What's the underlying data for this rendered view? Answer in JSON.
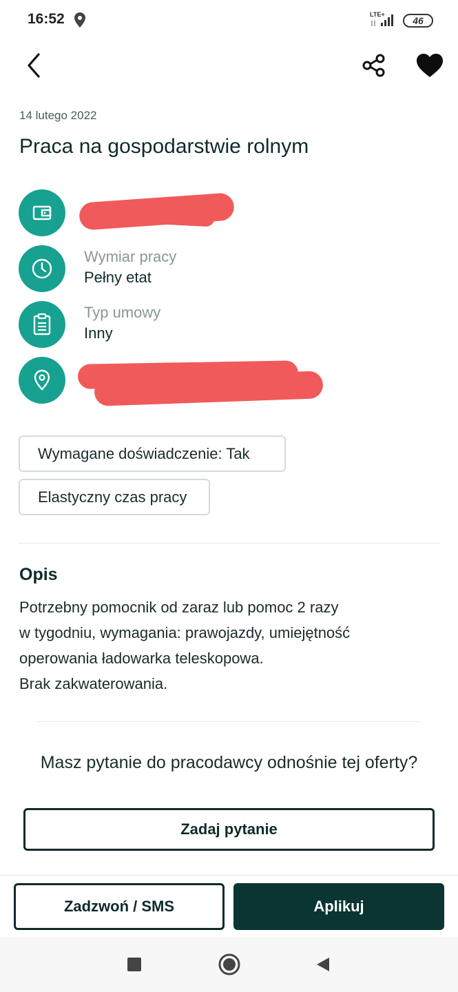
{
  "status_bar": {
    "time": "16:52",
    "network": "LTE+",
    "battery": "46"
  },
  "header": {
    "back_icon": "chevron-left-icon",
    "share_icon": "share-icon",
    "favorite_icon": "heart-icon"
  },
  "job": {
    "date": "14 lutego 2022",
    "title": "Praca na gospodarstwie rolnym",
    "info": [
      {
        "icon": "wallet-icon",
        "label": "",
        "value": "",
        "redacted": true
      },
      {
        "icon": "clock-icon",
        "label": "Wymiar pracy",
        "value": "Pełny etat"
      },
      {
        "icon": "clipboard-icon",
        "label": "Typ umowy",
        "value": "Inny"
      },
      {
        "icon": "location-pin-icon",
        "label": "",
        "value": "",
        "redacted": true
      }
    ],
    "tags": [
      "Wymagane doświadczenie: Tak",
      "Elastyczny czas pracy"
    ]
  },
  "description": {
    "title": "Opis",
    "lines": [
      "Potrzebny pomocnik od zaraz lub pomoc 2 razy",
      "w tygodniu, wymagania: prawojazdy, umiejętność",
      "operowania ładowarka teleskopowa.",
      "Brak zakwaterowania."
    ]
  },
  "question": {
    "text": "Masz pytanie do pracodawcy odnośnie tej oferty?",
    "button_label": "Zadaj pytanie"
  },
  "actions": {
    "call_label": "Zadzwoń / SMS",
    "apply_label": "Aplikuj"
  },
  "colors": {
    "accent": "#17a190",
    "primary_dark": "#0a3532",
    "redaction": "#f15a5a"
  }
}
